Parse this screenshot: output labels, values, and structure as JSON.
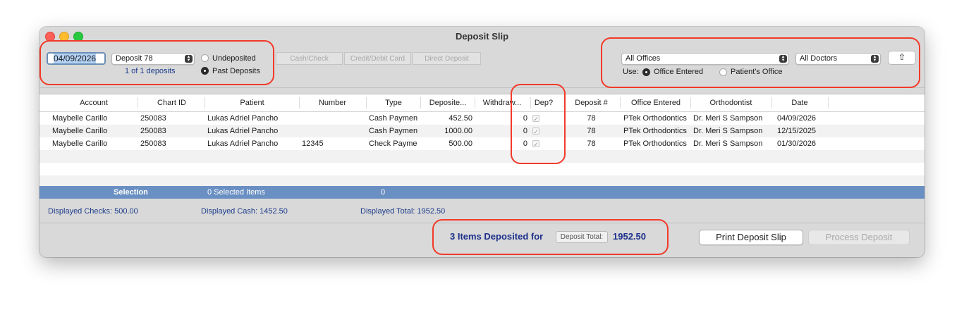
{
  "window": {
    "title": "Deposit Slip"
  },
  "header": {
    "date": "04/09/2026",
    "deposit_select": "Deposit 78",
    "deposits_count": "1 of 1 deposits",
    "radio_undeposited": "Undeposited",
    "radio_past": "Past Deposits",
    "tabs": [
      "Cash/Check",
      "Credit/Debit Card",
      "Direct Deposit"
    ],
    "offices_select": "All Offices",
    "doctors_select": "All Doctors",
    "use_label": "Use:",
    "radio_office_entered": "Office Entered",
    "radio_patients_office": "Patient's Office"
  },
  "table": {
    "columns": [
      "Account",
      "Chart ID",
      "Patient",
      "Number",
      "Type",
      "Deposite...",
      "Withdraw...",
      "Dep?",
      "Deposit #",
      "Office Entered",
      "Orthodontist",
      "Date"
    ],
    "rows": [
      [
        "Maybelle Carillo",
        "250083",
        "Lukas Adriel Pancho",
        "",
        "Cash Paymen",
        "452.50",
        "0",
        "✓",
        "78",
        "PTek Orthodontics",
        "Dr. Meri S Sampson",
        "04/09/2026"
      ],
      [
        "Maybelle Carillo",
        "250083",
        "Lukas Adriel Pancho",
        "",
        "Cash Paymen",
        "1000.00",
        "0",
        "✓",
        "78",
        "PTek Orthodontics",
        "Dr. Meri S Sampson",
        "12/15/2025"
      ],
      [
        "Maybelle Carillo",
        "250083",
        "Lukas Adriel Pancho",
        "12345",
        "Check Payme",
        "500.00",
        "0",
        "✓",
        "78",
        "PTek Orthodontics",
        "Dr. Meri S Sampson",
        "01/30/2026"
      ]
    ]
  },
  "selection": {
    "label": "Selection",
    "items": "0 Selected Items",
    "value": "0"
  },
  "totals": {
    "checks": "Displayed Checks:  500.00",
    "cash": "Displayed Cash:  1452.50",
    "total": "Displayed Total:  1952.50"
  },
  "footer": {
    "deposited_text": "3 Items Deposited for",
    "deposit_total_label": "Deposit Total:",
    "deposit_total_value": "1952.50",
    "print_button": "Print Deposit Slip",
    "process_button": "Process Deposit"
  },
  "icons": {
    "share": "share-icon",
    "stepper": "stepper-icon",
    "checkbox": "checkmark-icon"
  },
  "colors": {
    "selection_bar": "#6a8fc2",
    "annotation": "#f23a2a",
    "text_blue": "#1b3b8a"
  }
}
